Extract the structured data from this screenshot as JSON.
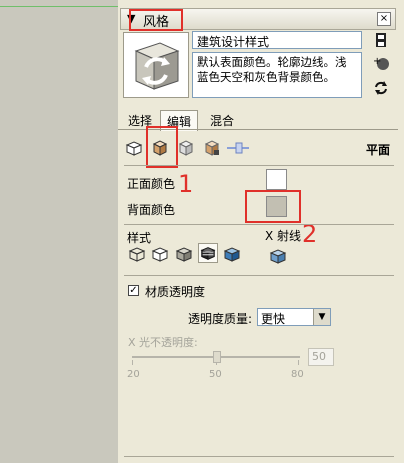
{
  "window": {
    "title": "风格"
  },
  "style": {
    "name": "建筑设计样式",
    "description": "默认表面颜色。轮廓边线。浅蓝色天空和灰色背景颜色。"
  },
  "tabs": [
    {
      "label": "选择",
      "active": false
    },
    {
      "label": "编辑",
      "active": true
    },
    {
      "label": "混合",
      "active": false
    }
  ],
  "edit_mode_label": "平面",
  "faces": {
    "front_color_label": "正面颜色",
    "back_color_label": "背面颜色",
    "front_color": "#ffffff",
    "back_color": "#c2bfb2"
  },
  "annotations": {
    "one": "1",
    "two": "2"
  },
  "style_section": {
    "style_label": "样式",
    "xray_label": "X 射线"
  },
  "transparency": {
    "enable_label": "材质透明度",
    "enabled": true,
    "quality_label": "透明度质量:",
    "quality_value": "更快",
    "xray_opacity_label": "X 光不透明度:",
    "xray_value": "50",
    "ticks": [
      "20",
      "50",
      "80"
    ]
  }
}
